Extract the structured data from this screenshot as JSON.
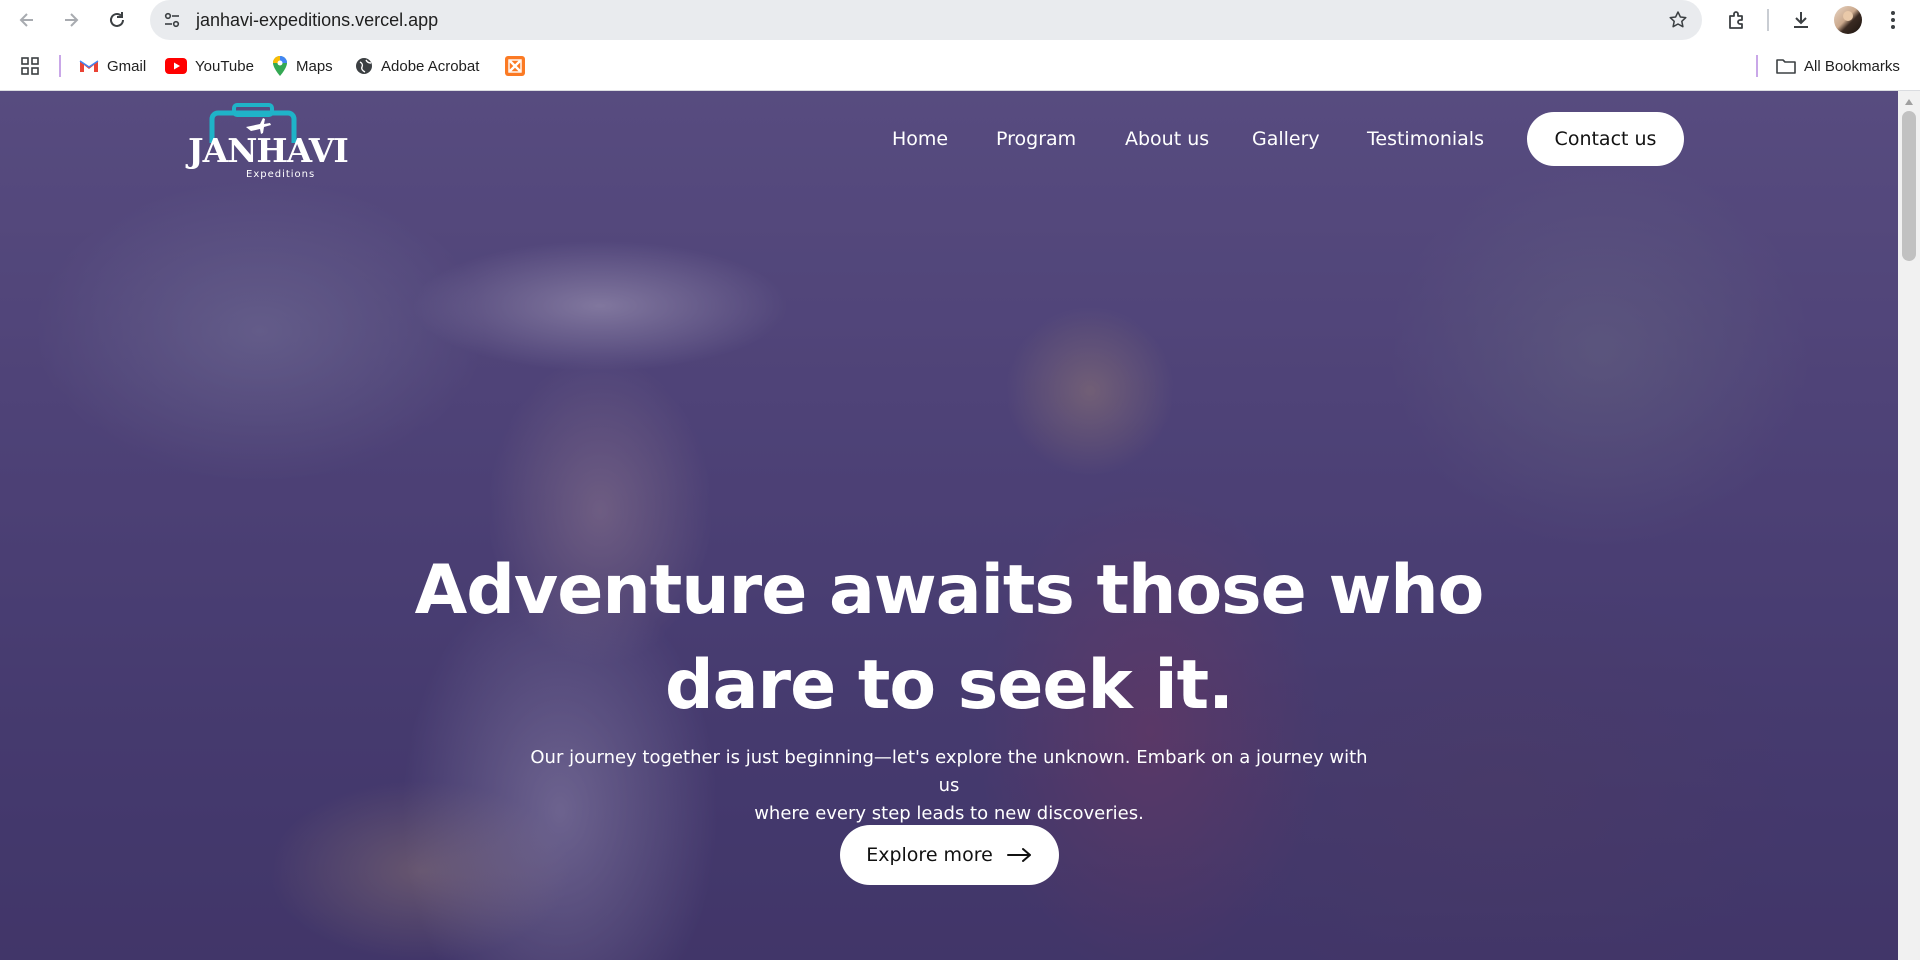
{
  "browser": {
    "url": "janhavi-expeditions.vercel.app",
    "bookmarks": [
      {
        "label": "Gmail",
        "icon": "gmail-icon"
      },
      {
        "label": "YouTube",
        "icon": "youtube-icon"
      },
      {
        "label": "Maps",
        "icon": "maps-icon"
      },
      {
        "label": "Adobe Acrobat",
        "icon": "globe-icon"
      },
      {
        "label": "",
        "icon": "xampp-icon"
      }
    ],
    "all_bookmarks_label": "All Bookmarks"
  },
  "site": {
    "logo": {
      "name": "JANHAVI",
      "tagline": "Expeditions"
    },
    "nav": {
      "home": "Home",
      "program": "Program",
      "about": "About us",
      "gallery": "Gallery",
      "testimonials": "Testimonials",
      "contact": "Contact us"
    },
    "hero": {
      "headline_line1": "Adventure awaits those who",
      "headline_line2": "dare to seek it.",
      "subtext_line1": "Our journey together is just beginning—let's explore the unknown. Embark on a journey with us",
      "subtext_line2": "where every step leads to new discoveries.",
      "cta": "Explore more"
    }
  },
  "colors": {
    "overlay": "#3a2c6e",
    "logo_accent": "#1fb3c8",
    "button_bg": "#ffffff",
    "bookmark_separator": "#c9a7e8"
  }
}
